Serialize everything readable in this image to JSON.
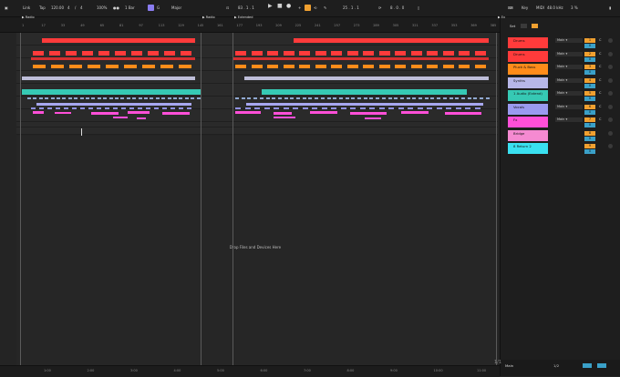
{
  "transport": {
    "link": "Link",
    "tap": "Tap",
    "tempo": "120.00",
    "sig_num": "4",
    "sig_den": "4",
    "zoom": "100%",
    "quant": "1 Bar",
    "key": "G",
    "scale": "Major",
    "position": "83 . 1 . 1",
    "loop_start": "25 . 1 . 1",
    "loop_len": "8 . 0 . 0",
    "key_label": "Key",
    "midi_label": "MIDI",
    "sample_rate": "48.0 kHz",
    "cpu": "3 %"
  },
  "ruler": {
    "ticks": [
      "1",
      "17",
      "33",
      "49",
      "65",
      "81",
      "97",
      "113",
      "129",
      "145",
      "161",
      "177",
      "193",
      "209",
      "225",
      "241",
      "257",
      "273",
      "289",
      "305",
      "321",
      "337",
      "353",
      "369",
      "385"
    ],
    "locators": [
      "Radio",
      "Radio",
      "Extended",
      "Ex"
    ]
  },
  "arrangement": {
    "audio_clip_1": "Audio (Feat) Audio (Extend)",
    "audio_clip_2": "Audio (Feat) Audio (Extend)",
    "audio_clip_3": "Audio",
    "drop_hint": "Drop Files and Devices Here"
  },
  "bottom_ruler": [
    "1:00",
    "2:00",
    "3:00",
    "4:00",
    "5:00",
    "6:00",
    "7:00",
    "8:00",
    "9:00",
    "10:00",
    "11:00"
  ],
  "mixer": {
    "set_label": "Set",
    "tracks": [
      {
        "name": "Drums",
        "color": "#ff3b3b",
        "route": "Main",
        "vol": "0",
        "pan": "C",
        "num": "1"
      },
      {
        "name": "Drums",
        "color": "#ff3b3b",
        "route": "Main",
        "vol": "0",
        "pan": "C",
        "num": "2"
      },
      {
        "name": "Pluck & Bass",
        "color": "#ff8c1a",
        "route": "Main",
        "vol": "0",
        "pan": "C",
        "num": "3"
      },
      {
        "name": "Synths",
        "color": "#b7b7e8",
        "route": "Main",
        "vol": "0",
        "pan": "C",
        "num": "4"
      },
      {
        "name": "1 Audio (Extend)",
        "color": "#36c9b4",
        "route": "Main",
        "vol": "0",
        "pan": "C",
        "num": "5"
      },
      {
        "name": "Vocals",
        "color": "#9a9af0",
        "route": "Main",
        "vol": "0",
        "pan": "C",
        "num": "6"
      },
      {
        "name": "Fx",
        "color": "#ff4fd8",
        "route": "Main",
        "vol": "0",
        "pan": "C",
        "num": "7"
      },
      {
        "name": "Bridge",
        "color": "#f58ad1",
        "route": "",
        "vol": "0",
        "pan": "",
        "num": "8"
      },
      {
        "name": "8 Return 2",
        "color": "#3ae0f0",
        "route": "",
        "vol": "0",
        "pan": "",
        "num": "9"
      }
    ],
    "main_label": "Main",
    "main_route": "1/2",
    "main_vol": "0",
    "footer_label": "1/1"
  },
  "colors": {
    "drums": "#ff3b3b",
    "orange": "#ff8c1a",
    "teal": "#36c9b4",
    "lavender": "#a7a7f0",
    "pink": "#ff4fd8"
  }
}
